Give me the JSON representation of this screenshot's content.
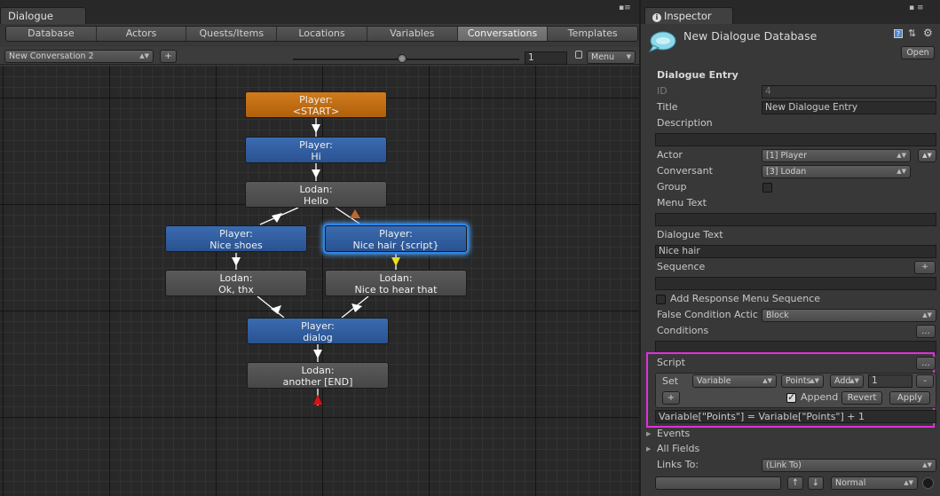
{
  "dialogue_window": {
    "tab_label": "Dialogue",
    "tabs": [
      "Database",
      "Actors",
      "Quests/Items",
      "Locations",
      "Variables",
      "Conversations",
      "Templates"
    ],
    "active_tab": "Conversations",
    "conversation_select": "New Conversation 2",
    "add_label": "+",
    "zoom_value": "1",
    "menu_label": "Menu",
    "nodes": [
      {
        "actor": "Player:",
        "text": "<START>",
        "kind": "start"
      },
      {
        "actor": "Player:",
        "text": "Hi",
        "kind": "player"
      },
      {
        "actor": "Lodan:",
        "text": "Hello",
        "kind": "npc"
      },
      {
        "actor": "Player:",
        "text": "Nice shoes",
        "kind": "player"
      },
      {
        "actor": "Player:",
        "text": "Nice hair {script}",
        "kind": "player-selected"
      },
      {
        "actor": "Lodan:",
        "text": "Ok, thx",
        "kind": "npc"
      },
      {
        "actor": "Lodan:",
        "text": "Nice to hear that",
        "kind": "npc"
      },
      {
        "actor": "Player:",
        "text": "dialog",
        "kind": "player"
      },
      {
        "actor": "Lodan:",
        "text": "another [END]",
        "kind": "npc"
      }
    ],
    "colors": {
      "start": "#c06a14",
      "player": "#3260a3",
      "npc": "#515151",
      "selected_glow": "#3a95f5",
      "arrow_normal": "#ffffff",
      "arrow_script": "#f0e01a",
      "arrow_back": "#c0682a",
      "arrow_end": "#e01010"
    }
  },
  "inspector": {
    "tab_label": "Inspector",
    "title": "New Dialogue Database",
    "open_label": "Open",
    "section_title": "Dialogue Entry",
    "id_label": "ID",
    "id_value": "4",
    "title_label": "Title",
    "title_value": "New Dialogue Entry",
    "description_label": "Description",
    "description_value": "",
    "actor_label": "Actor",
    "actor_value": "[1] Player",
    "conversant_label": "Conversant",
    "conversant_value": "[3] Lodan",
    "group_label": "Group",
    "menu_text_label": "Menu Text",
    "dialogue_text_label": "Dialogue Text",
    "dialogue_text_value": "Nice hair",
    "sequence_label": "Sequence",
    "add_response_label": "Add Response Menu Sequence",
    "false_condition_label": "False Condition Actic",
    "false_condition_value": "Block",
    "conditions_label": "Conditions",
    "script_label": "Script",
    "ellipsis": "...",
    "script_set": "Set",
    "script_type": "Variable",
    "script_var": "Points",
    "script_op": "Add",
    "script_amount": "1",
    "script_minus": "-",
    "script_plus": "+",
    "append_label": "Append",
    "revert_label": "Revert",
    "apply_label": "Apply",
    "script_result": "Variable[\"Points\"] = Variable[\"Points\"] + 1",
    "events_label": "Events",
    "all_fields_label": "All Fields",
    "links_to_label": "Links To:",
    "links_to_value": "(Link To)",
    "link_mode_value": "Normal",
    "highlight_color": "#e22ee0"
  }
}
